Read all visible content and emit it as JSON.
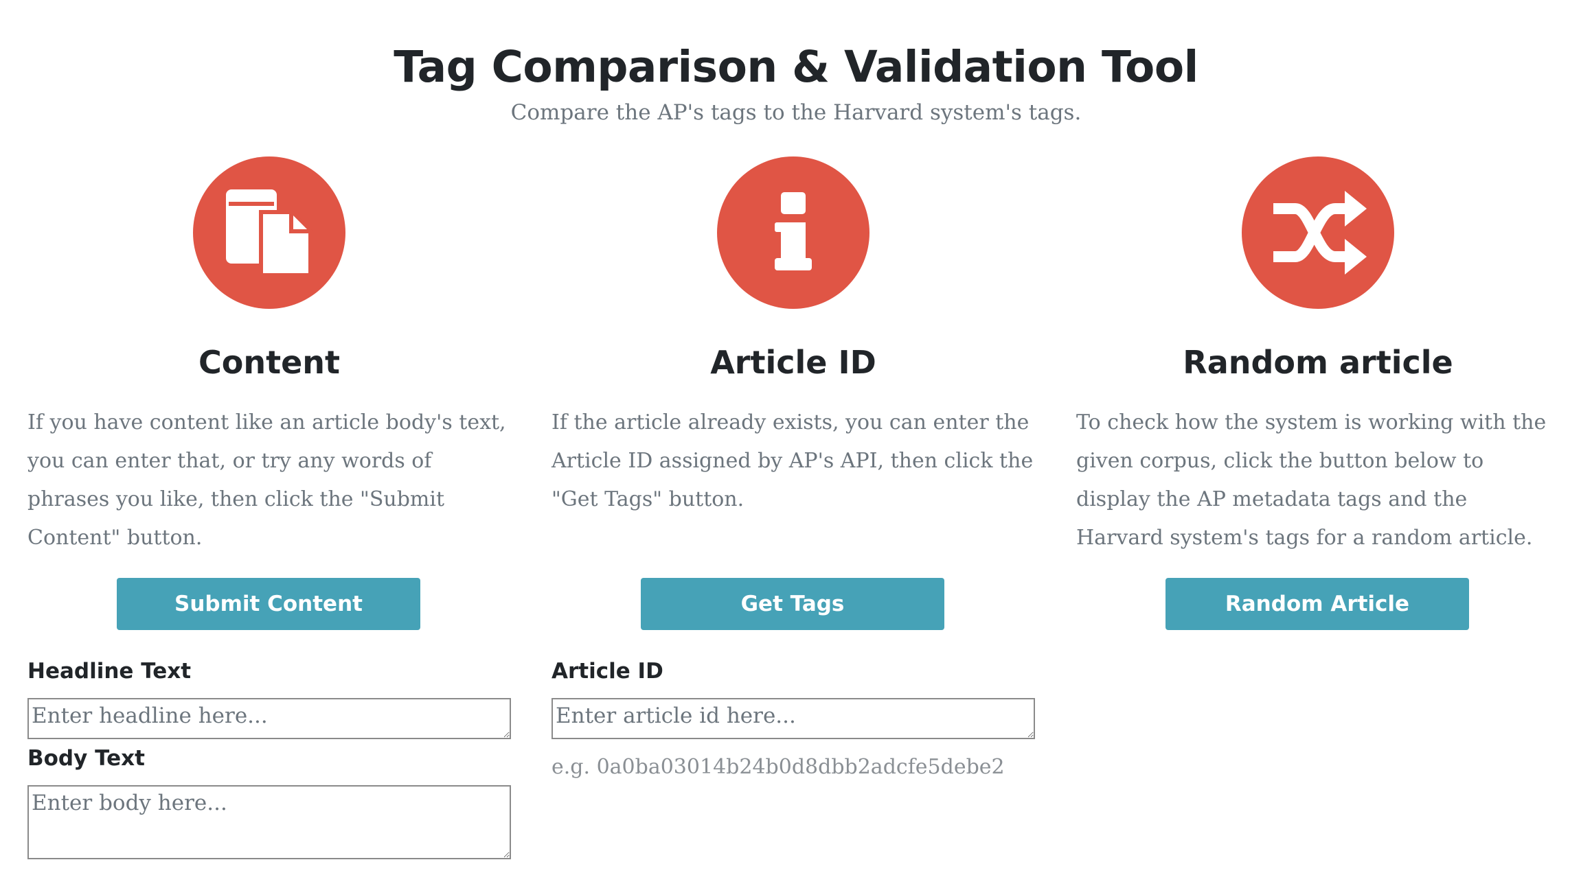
{
  "header": {
    "title": "Tag Comparison & Validation Tool",
    "subtitle": "Compare the AP's tags to the Harvard system's tags."
  },
  "columns": [
    {
      "icon": "document-copy-icon",
      "heading": "Content",
      "description": "If you have content like an article body's text, you can enter that, or try any words of phrases you like, then click the \"Submit Content\" button.",
      "button_label": "Submit Content"
    },
    {
      "icon": "info-icon",
      "heading": "Article ID",
      "description": "If the article already exists, you can enter the Article ID assigned by AP's API, then click the \"Get Tags\" button.",
      "button_label": "Get Tags"
    },
    {
      "icon": "shuffle-icon",
      "heading": "Random article",
      "description": "To check how the system is working with the given corpus, click the button below to display the AP metadata tags and the Harvard system's tags for a random article.",
      "button_label": "Random Article"
    }
  ],
  "content_form": {
    "headline_label": "Headline Text",
    "headline_placeholder": "Enter headline here...",
    "body_label": "Body Text",
    "body_placeholder": "Enter body here..."
  },
  "article_form": {
    "label": "Article ID",
    "placeholder": "Enter article id here...",
    "hint": "e.g. 0a0ba03014b24b0d8dbb2adcfe5debe2"
  },
  "colors": {
    "accent": "#e05545",
    "button": "#46a2b7",
    "muted_text": "#6c757d"
  }
}
